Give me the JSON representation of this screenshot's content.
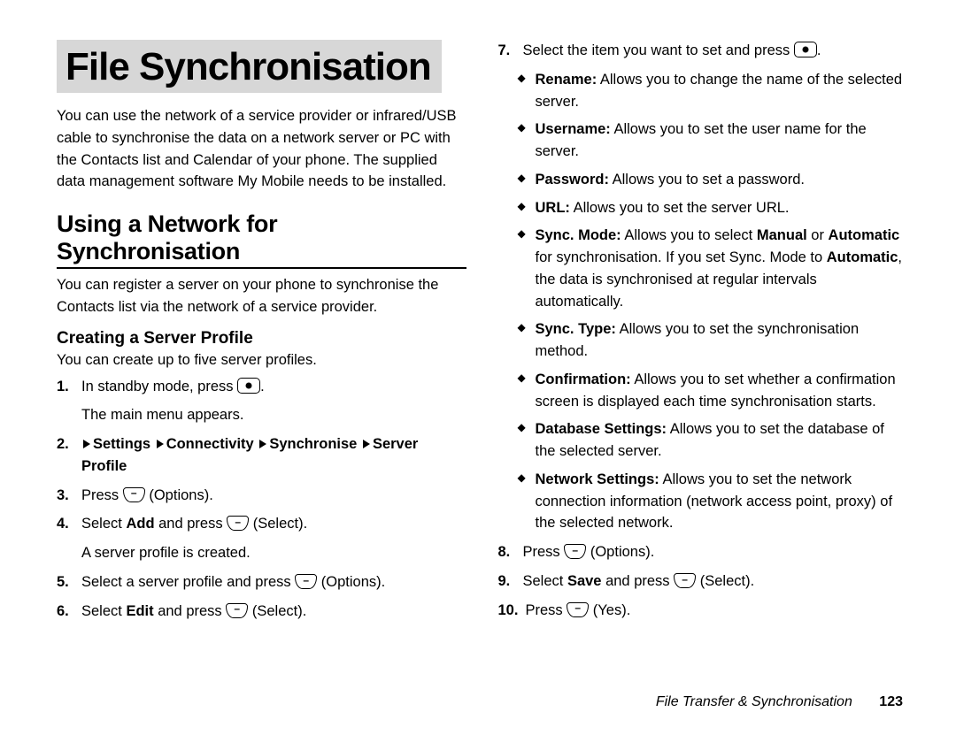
{
  "title": "File Synchronisation",
  "intro": "You can use the network of a service provider or infrared/USB cable to synchronise the data on a network server or PC with the Contacts list and Calendar of your phone. The supplied data management software My Mobile needs to be installed.",
  "section_heading": "Using a Network for Synchronisation",
  "section_lead": "You can register a server on your phone to synchronise the Contacts list via the network of a service provider.",
  "sub_heading": "Creating a Server Profile",
  "sub_intro": "You can create up to five server profiles.",
  "steps": {
    "s1": {
      "num": "1.",
      "pre": "In standby mode, press ",
      "post": ".",
      "follow": "The main menu appears."
    },
    "s2": {
      "num": "2.",
      "nav0": "Settings",
      "nav1": "Connectivity",
      "nav2": "Synchronise",
      "nav3": "Server Profile"
    },
    "s3": {
      "num": "3.",
      "pre": "Press ",
      "post": " (Options)."
    },
    "s4": {
      "num": "4.",
      "pre": "Select ",
      "bold": "Add",
      "mid": " and press ",
      "post": " (Select).",
      "follow": "A server profile is created."
    },
    "s5": {
      "num": "5.",
      "pre": "Select a server profile and press ",
      "post": " (Options)."
    },
    "s6": {
      "num": "6.",
      "pre": "Select ",
      "bold": "Edit",
      "mid": " and press ",
      "post": " (Select)."
    },
    "s7": {
      "num": "7.",
      "pre": "Select the item you want to set and press ",
      "post": "."
    },
    "s8": {
      "num": "8.",
      "pre": "Press ",
      "post": " (Options)."
    },
    "s9": {
      "num": "9.",
      "pre": "Select ",
      "bold": "Save",
      "mid": " and press ",
      "post": " (Select)."
    },
    "s10": {
      "num": "10.",
      "pre": "Press ",
      "post": " (Yes)."
    }
  },
  "options": {
    "o1": {
      "label": "Rename:",
      "text": " Allows you to change the name of the selected server."
    },
    "o2": {
      "label": "Username:",
      "text": " Allows you to set the user name for the server."
    },
    "o3": {
      "label": "Password:",
      "text": " Allows you to set a password."
    },
    "o4": {
      "label": "URL:",
      "text": " Allows you to set the server URL."
    },
    "o5": {
      "label": "Sync. Mode:",
      "text_a": " Allows you to select ",
      "b1": "Manual",
      "text_b": " or ",
      "b2": "Automatic",
      "text_c": " for synchronisation. If you set Sync. Mode to ",
      "b3": "Automatic",
      "text_d": ", the data is synchronised at regular intervals automatically."
    },
    "o6": {
      "label": "Sync. Type:",
      "text": " Allows you to set the synchronisation method."
    },
    "o7": {
      "label": "Confirmation:",
      "text": " Allows you to set whether a confirmation screen is displayed each time synchronisation starts."
    },
    "o8": {
      "label": "Database Settings:",
      "text": " Allows you to set the database of the selected server."
    },
    "o9": {
      "label": "Network Settings:",
      "text": " Allows you to set the network connection information (network access point, proxy) of the selected network."
    }
  },
  "footer": {
    "title": "File Transfer & Synchronisation",
    "page": "123"
  }
}
